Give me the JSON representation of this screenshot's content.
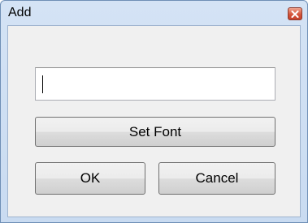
{
  "window": {
    "title": "Add",
    "close_icon": "close-icon"
  },
  "form": {
    "text_value": ""
  },
  "buttons": {
    "set_font": "Set Font",
    "ok": "OK",
    "cancel": "Cancel"
  },
  "colors": {
    "titlebar": "#d4e3f5",
    "client": "#f0f0f0",
    "close_button": "#d4553b"
  }
}
